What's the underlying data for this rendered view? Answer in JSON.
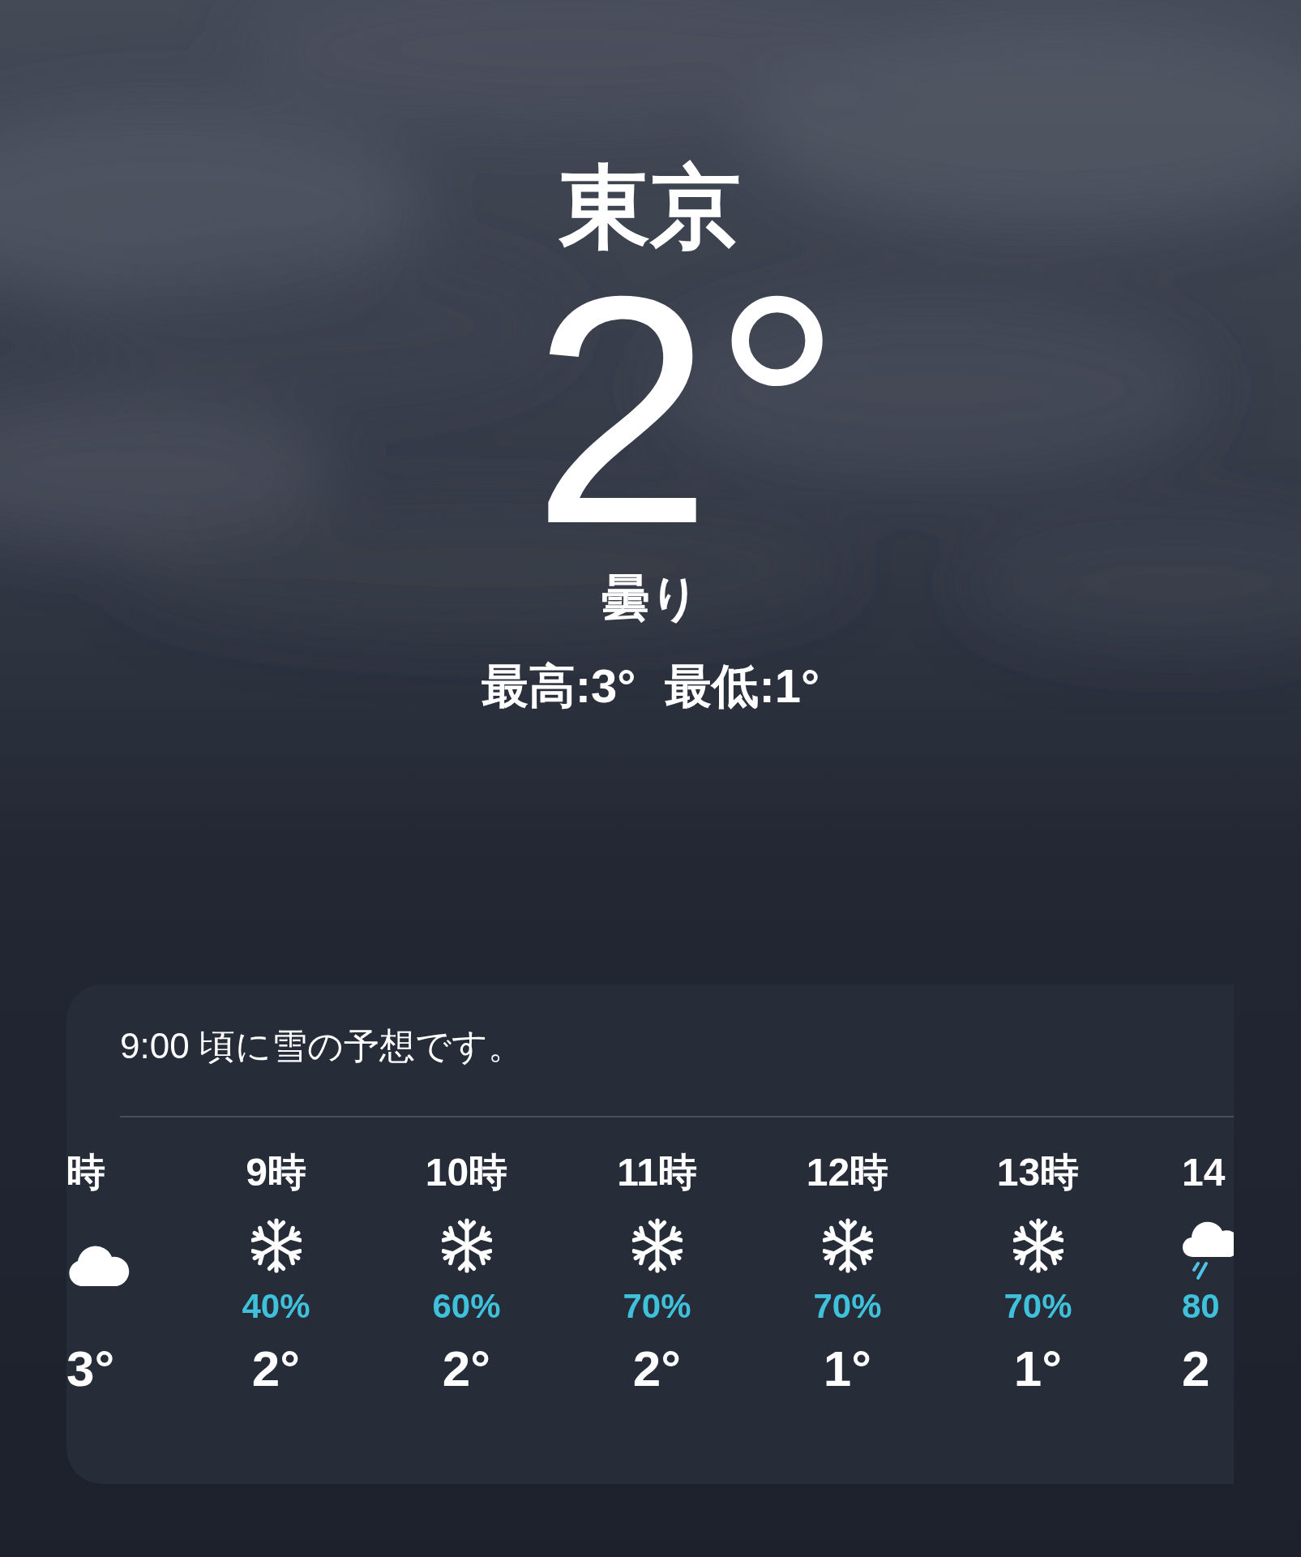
{
  "location": "東京",
  "temperature": "2°",
  "condition": "曇り",
  "high": "最高:3°",
  "low": "最低:1°",
  "forecast": {
    "summary": "9:00 頃に雪の予想です。",
    "hourly": [
      {
        "hour": "時",
        "kind": "cloud",
        "temp": "3°"
      },
      {
        "hour": "9時",
        "kind": "snow",
        "precip": "40%",
        "temp": "2°"
      },
      {
        "hour": "10時",
        "kind": "snow",
        "precip": "60%",
        "temp": "2°"
      },
      {
        "hour": "11時",
        "kind": "snow",
        "precip": "70%",
        "temp": "2°"
      },
      {
        "hour": "12時",
        "kind": "snow",
        "precip": "70%",
        "temp": "1°"
      },
      {
        "hour": "13時",
        "kind": "snow",
        "precip": "70%",
        "temp": "1°"
      },
      {
        "hour": "14",
        "kind": "rain",
        "precip": "80",
        "temp": "2"
      }
    ]
  }
}
